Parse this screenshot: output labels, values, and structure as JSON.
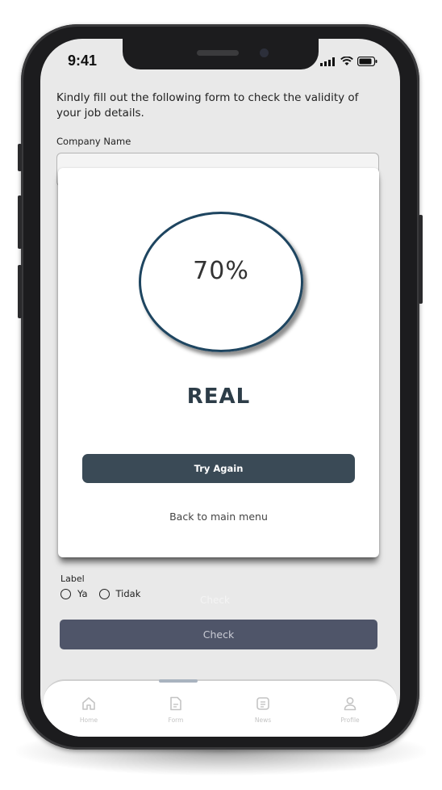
{
  "status_bar": {
    "time": "9:41"
  },
  "form": {
    "instructions": "Kindly fill out the following form to check the validity of your job details.",
    "company_name_label": "Company Name",
    "label_field": "Label",
    "radio_options": [
      "Ya",
      "Tidak"
    ],
    "ghost_check_text": "Check",
    "check_button": "Check"
  },
  "result_modal": {
    "percentage": "70%",
    "verdict": "REAL",
    "try_again_button": "Try Again",
    "back_link": "Back to main menu",
    "ring_color": "#1e4560",
    "button_color": "#3a4a56"
  },
  "tab_bar": {
    "items": [
      {
        "label": "Home",
        "icon": "home-icon"
      },
      {
        "label": "Form",
        "icon": "form-icon"
      },
      {
        "label": "News",
        "icon": "news-icon"
      },
      {
        "label": "Profile",
        "icon": "profile-icon"
      }
    ],
    "active_tab": "Form"
  }
}
